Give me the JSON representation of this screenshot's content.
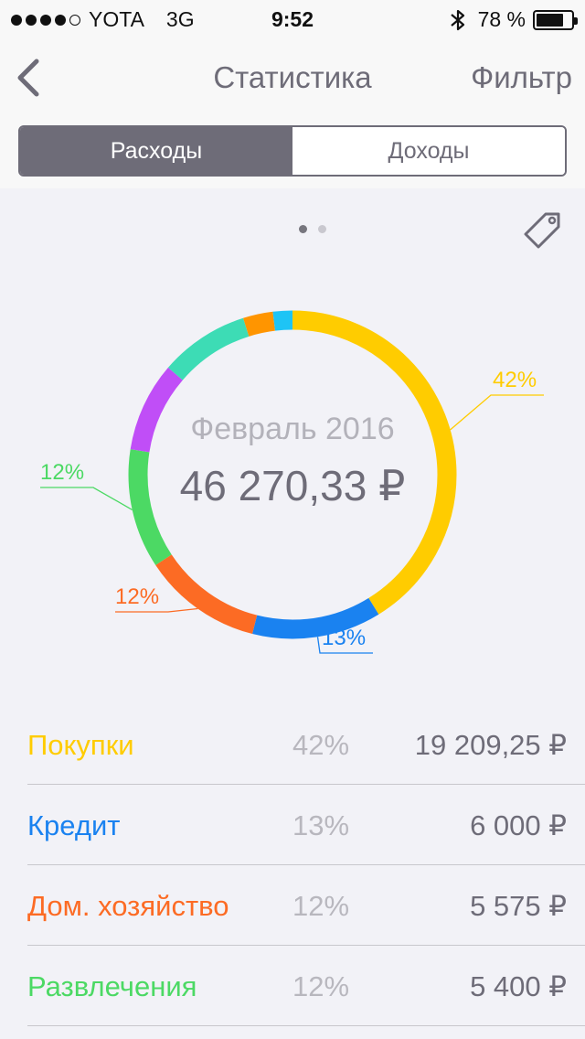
{
  "status_bar": {
    "carrier": "YOTA",
    "network": "3G",
    "time": "9:52",
    "battery_text": "78 %",
    "battery_level": 0.78,
    "signal_bars_filled": 4,
    "signal_bars_total": 5
  },
  "nav": {
    "back_icon": "chevron-left-icon",
    "title": "Статистика",
    "filter_label": "Фильтр"
  },
  "segment": {
    "expenses_label": "Расходы",
    "income_label": "Доходы",
    "selected": "expenses"
  },
  "chart": {
    "page_count": 2,
    "current_page": 1,
    "tag_icon": "tag-icon",
    "month": "Февраль 2016",
    "total": "46 270,33 ₽"
  },
  "colors": {
    "yellow": "#ffcc00",
    "blue": "#1a82f0",
    "orange": "#fc6b24",
    "green": "#4cd964",
    "purple": "#c04ef7",
    "teal": "#3ddcb5",
    "amber": "#ff9500",
    "cyan": "#1ec4f5"
  },
  "chart_data": {
    "type": "pie",
    "donut": true,
    "slices": [
      {
        "name": "Покупки",
        "value": 42,
        "label": "42%",
        "color": "#ffcc00"
      },
      {
        "name": "Кредит",
        "value": 13,
        "label": "13%",
        "color": "#1a82f0"
      },
      {
        "name": "Дом. хозяйство",
        "value": 12,
        "label": "12%",
        "color": "#fc6b24"
      },
      {
        "name": "Развлечения",
        "value": 12,
        "label": "12%",
        "color": "#4cd964"
      },
      {
        "name": "",
        "value": 9,
        "label": "",
        "color": "#c04ef7"
      },
      {
        "name": "",
        "value": 9,
        "label": "",
        "color": "#3ddcb5"
      },
      {
        "name": "",
        "value": 3,
        "label": "",
        "color": "#ff9500"
      },
      {
        "name": "",
        "value": 2,
        "label": "",
        "color": "#1ec4f5"
      }
    ]
  },
  "categories": [
    {
      "name": "Покупки",
      "percent": "42%",
      "amount": "19 209,25 ₽",
      "color": "#ffcc00"
    },
    {
      "name": "Кредит",
      "percent": "13%",
      "amount": "6 000 ₽",
      "color": "#1a82f0"
    },
    {
      "name": "Дом. хозяйство",
      "percent": "12%",
      "amount": "5 575 ₽",
      "color": "#fc6b24"
    },
    {
      "name": "Развлечения",
      "percent": "12%",
      "amount": "5 400 ₽",
      "color": "#4cd964"
    }
  ]
}
